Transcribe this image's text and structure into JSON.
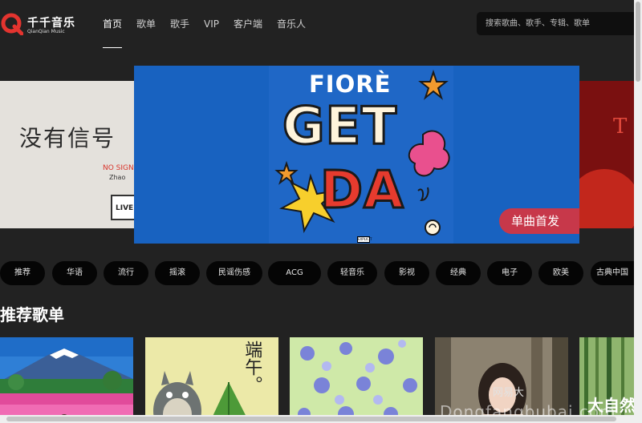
{
  "brand": {
    "name_cn": "千千音乐",
    "name_en": "QianQian Music",
    "accent": "#e3342f"
  },
  "nav": {
    "items": [
      {
        "label": "首页",
        "active": true
      },
      {
        "label": "歌单",
        "active": false
      },
      {
        "label": "歌手",
        "active": false
      },
      {
        "label": "VIP",
        "active": false
      },
      {
        "label": "客户端",
        "active": false
      },
      {
        "label": "音乐人",
        "active": false
      }
    ]
  },
  "search": {
    "placeholder": "搜索歌曲、歌手、专辑、歌单"
  },
  "banner": {
    "main": {
      "artist": "FIORÈ",
      "title_line1": "GET",
      "title_line2": "DA",
      "badge": "单曲首发",
      "advisory": "EXPLICIT"
    },
    "left": {
      "title": "没有信号",
      "sub1": "NO SIGNAL",
      "sub2": "Zhao",
      "tag": "LIVE"
    },
    "right": {
      "letter": "T"
    }
  },
  "categories": [
    "推荐",
    "华语",
    "流行",
    "摇滚",
    "民谣伤感",
    "ACG",
    "轻音乐",
    "影视",
    "经典",
    "电子",
    "欧美",
    "古典中国"
  ],
  "section": {
    "title": "推荐歌单"
  },
  "playlists": [
    {
      "image": "mountain-fuji"
    },
    {
      "image": "duanwu-totoro",
      "caption": "端午。"
    },
    {
      "image": "floral-pattern"
    },
    {
      "image": "girl-forest"
    },
    {
      "image": "bamboo-forest"
    }
  ],
  "watermark": {
    "site": "Dongfangbubai.com",
    "badge": "网易大",
    "corner": "大自然"
  }
}
